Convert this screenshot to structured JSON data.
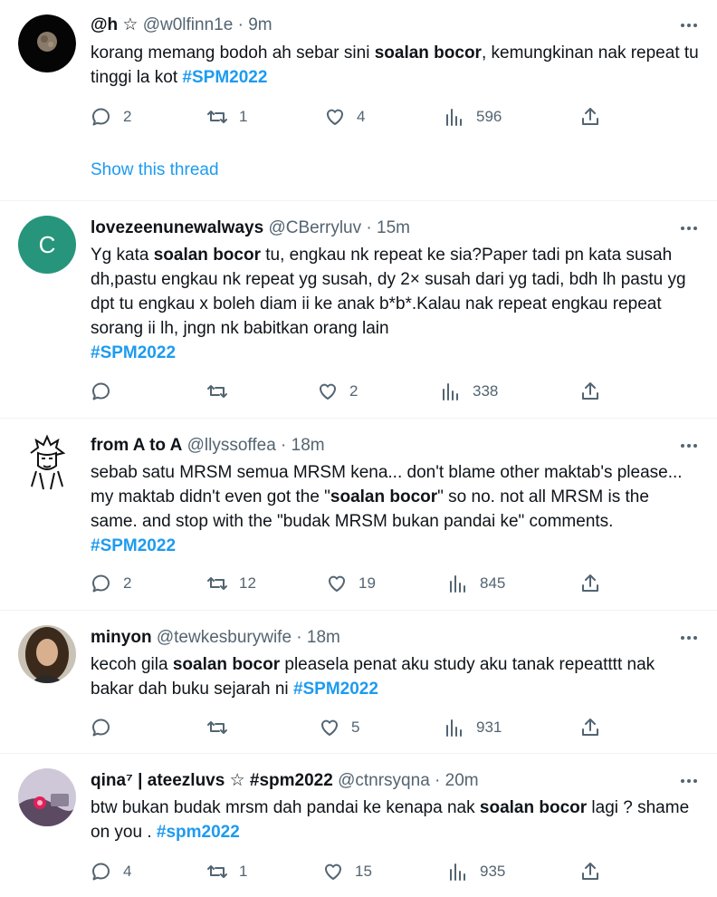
{
  "tweets": [
    {
      "name": "@h ☆",
      "handle": "@w0lfinn1e",
      "dot": "·",
      "time": "9m",
      "body": [
        {
          "t": "korang memang bodoh ah sebar sini "
        },
        {
          "t": "soalan bocor",
          "b": true
        },
        {
          "t": ", kemungkinan nak repeat tu tinggi la kot "
        },
        {
          "t": "#SPM2022",
          "tag": true
        }
      ],
      "replies": "2",
      "retweets": "1",
      "likes": "4",
      "views": "596",
      "show_thread": "Show this thread"
    },
    {
      "name": "lovezeenunewalways",
      "handle": "@CBerryluv",
      "dot": "·",
      "time": "15m",
      "avatar_letter": "C",
      "body": [
        {
          "t": "Yg kata "
        },
        {
          "t": "soalan bocor",
          "b": true
        },
        {
          "t": " tu, engkau nk repeat ke sia?Paper tadi pn kata susah dh,pastu engkau nk repeat yg susah, dy 2× susah dari yg tadi, bdh lh pastu yg dpt tu engkau x boleh diam ii ke anak b*b*.Kalau nak repeat engkau repeat sorang ii lh, jngn nk babitkan orang lain "
        },
        {
          "t": "#SPM2022",
          "tag": true,
          "br": true
        }
      ],
      "replies": "",
      "retweets": "",
      "likes": "2",
      "views": "338"
    },
    {
      "name": "from A to A",
      "handle": "@llyssoffea",
      "dot": "·",
      "time": "18m",
      "body": [
        {
          "t": "sebab satu MRSM semua MRSM kena... don't blame other maktab's please... my maktab didn't even got the \""
        },
        {
          "t": "soalan bocor",
          "b": true
        },
        {
          "t": "\" so no. not all MRSM is the same. and stop with the \"budak MRSM bukan pandai ke\" comments. "
        },
        {
          "t": "#SPM2022",
          "tag": true
        }
      ],
      "replies": "2",
      "retweets": "12",
      "likes": "19",
      "views": "845"
    },
    {
      "name": "minyon",
      "handle": "@tewkesburywife",
      "dot": "·",
      "time": "18m",
      "body": [
        {
          "t": "kecoh gila "
        },
        {
          "t": "soalan bocor",
          "b": true
        },
        {
          "t": " pleasela penat aku study aku tanak repeatttt nak bakar dah buku sejarah ni "
        },
        {
          "t": "#SPM2022",
          "tag": true
        }
      ],
      "replies": "",
      "retweets": "",
      "likes": "5",
      "views": "931"
    },
    {
      "name": "qina⁷ | ateezluvs ☆ #spm2022",
      "handle": "@ctnrsyqna",
      "dot": "·",
      "time": "20m",
      "body": [
        {
          "t": "btw bukan budak mrsm dah pandai ke kenapa nak "
        },
        {
          "t": "soalan bocor",
          "b": true
        },
        {
          "t": " lagi ? shame on you . "
        },
        {
          "t": "#spm2022",
          "tag": true
        }
      ],
      "replies": "4",
      "retweets": "1",
      "likes": "15",
      "views": "935"
    }
  ],
  "icons": {
    "reply": "reply-icon",
    "retweet": "retweet-icon",
    "like": "heart-icon",
    "views": "views-icon",
    "share": "share-icon",
    "more": "more-icon"
  },
  "colors": {
    "link": "#1d9bf0",
    "muted": "#536471",
    "text": "#0f1419",
    "avatar_c": "#26957c"
  }
}
